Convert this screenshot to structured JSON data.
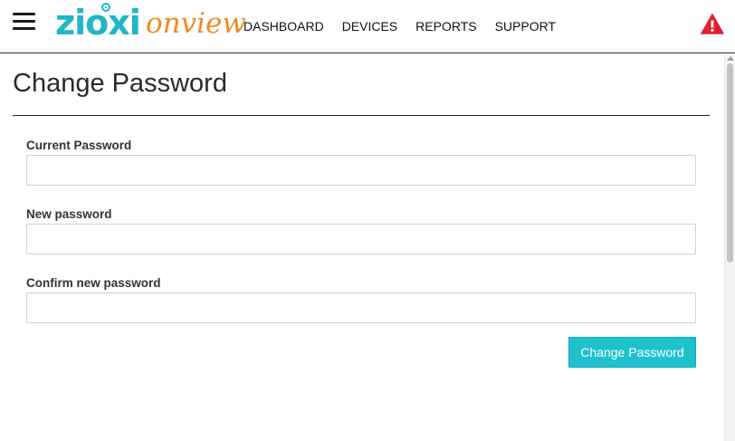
{
  "navbar": {
    "menu_icon": "hamburger-menu-icon",
    "logo": {
      "part1": "zioxi",
      "part2": "onview",
      "color1": "#1fb6c8",
      "color2": "#f08a24"
    },
    "links": [
      "DASHBOARD",
      "DEVICES",
      "REPORTS",
      "SUPPORT"
    ],
    "alert_icon": "warning-triangle-icon",
    "alert_color": "#e0202e"
  },
  "page": {
    "title": "Change Password"
  },
  "form": {
    "current_password": {
      "label": "Current Password",
      "value": "",
      "placeholder": ""
    },
    "new_password": {
      "label": "New password",
      "value": "",
      "placeholder": ""
    },
    "confirm_password": {
      "label": "Confirm new password",
      "value": "",
      "placeholder": ""
    },
    "submit_label": "Change Password",
    "accent_color": "#1fc1cd"
  }
}
